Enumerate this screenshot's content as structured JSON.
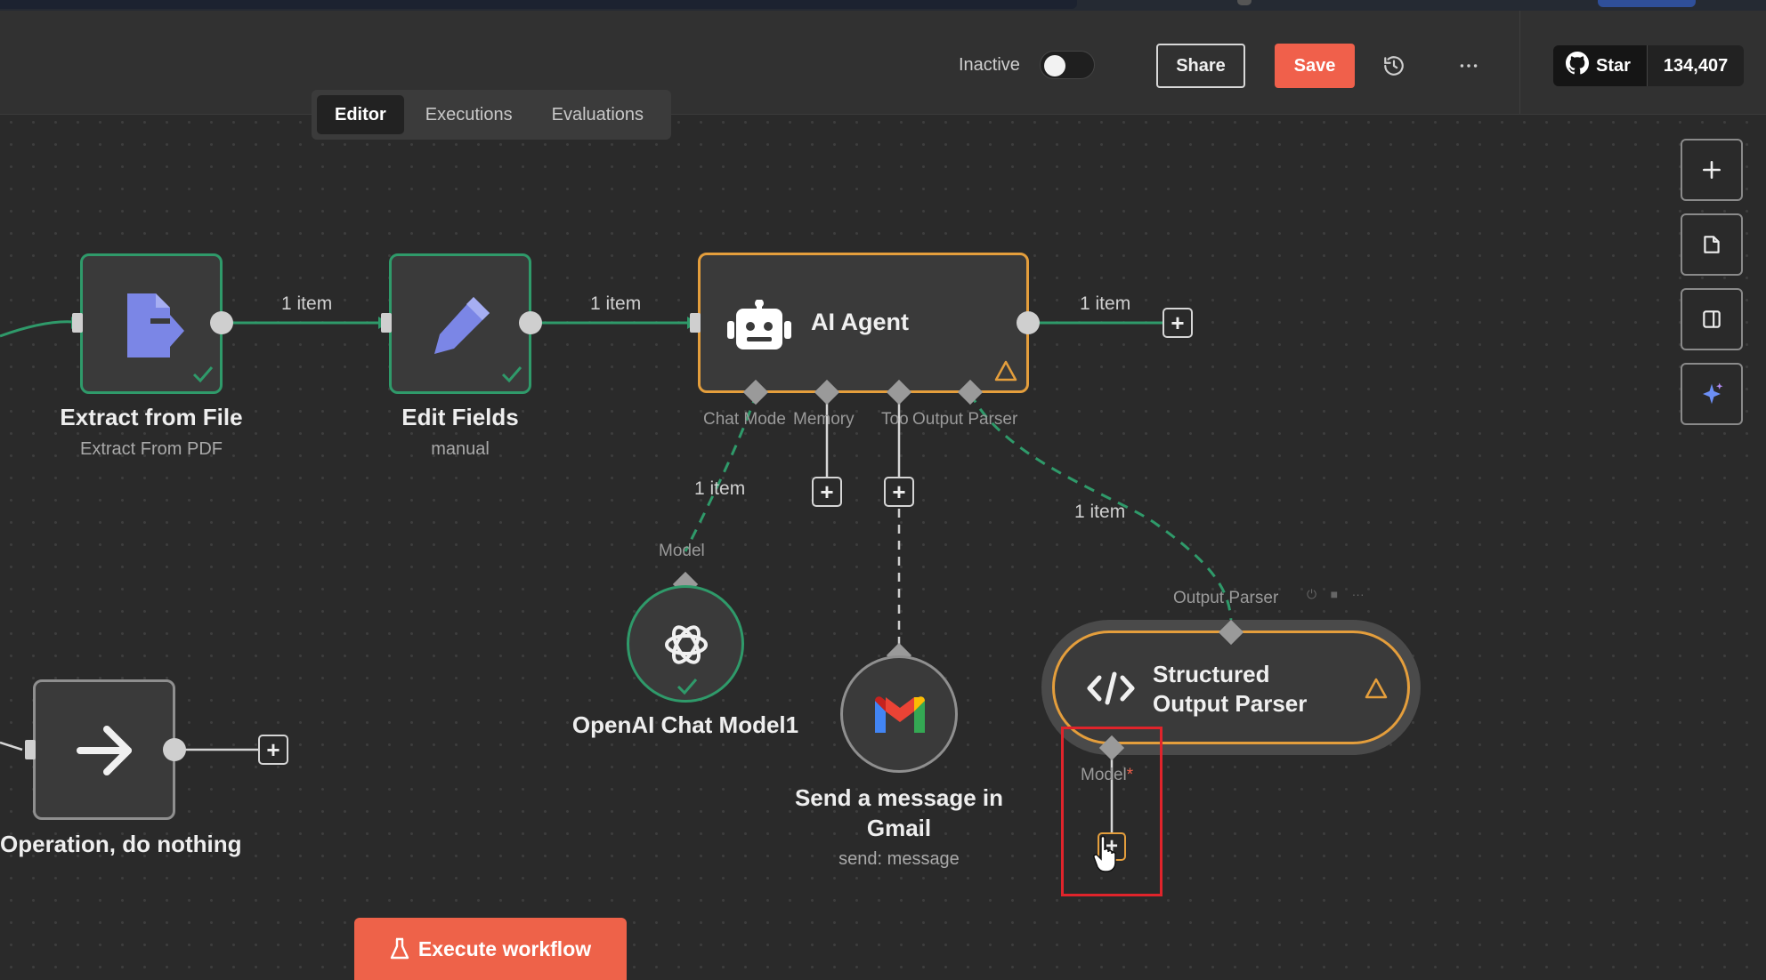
{
  "header": {
    "status_label": "Inactive",
    "share_label": "Share",
    "save_label": "Save",
    "history_icon": "history-icon",
    "more_icon": "more-icon",
    "github": {
      "star_label": "Star",
      "star_count": "134,407"
    }
  },
  "tabs": [
    {
      "label": "Editor",
      "active": true
    },
    {
      "label": "Executions",
      "active": false
    },
    {
      "label": "Evaluations",
      "active": false
    }
  ],
  "canvas_controls": [
    "zoom-in-icon",
    "sticky-note-icon",
    "panel-icon",
    "ai-assist-icon"
  ],
  "nodes": {
    "extract": {
      "title": "Extract from File",
      "subtitle": "Extract From PDF",
      "icon": "file-export-icon",
      "status": "success"
    },
    "edit": {
      "title": "Edit Fields",
      "subtitle": "manual",
      "icon": "pencil-icon",
      "status": "success"
    },
    "agent": {
      "title": "AI Agent",
      "icon": "robot-icon",
      "warning": true,
      "ports": {
        "chat_model": "Chat Mode",
        "memory": "Memory",
        "tool": "Too",
        "output_parser": "Output Parser"
      }
    },
    "openai": {
      "title": "OpenAI Chat Model1",
      "port_label": "Model",
      "icon": "openai-icon",
      "status": "success"
    },
    "gmail": {
      "title": "Send a message in Gmail",
      "subtitle": "send: message",
      "icon": "gmail-icon"
    },
    "parser": {
      "title": "Structured Output Parser",
      "port_label": "Output Parser",
      "model_label": "Model",
      "icon": "code-icon",
      "warning": true
    },
    "noop": {
      "title": "Operation, do nothing",
      "icon": "arrow-right-icon"
    }
  },
  "connections": {
    "extract_to_edit": "1 item",
    "edit_to_agent": "1 item",
    "agent_out": "1 item",
    "model_to_agent": "1 item",
    "parser_to_agent": "1 item"
  },
  "execute_label": "Execute workflow",
  "colors": {
    "success": "#2f9a6a",
    "warning": "#e49e3c",
    "save": "#f0604b",
    "execute": "#ee6249",
    "highlight": "#e0242b"
  }
}
